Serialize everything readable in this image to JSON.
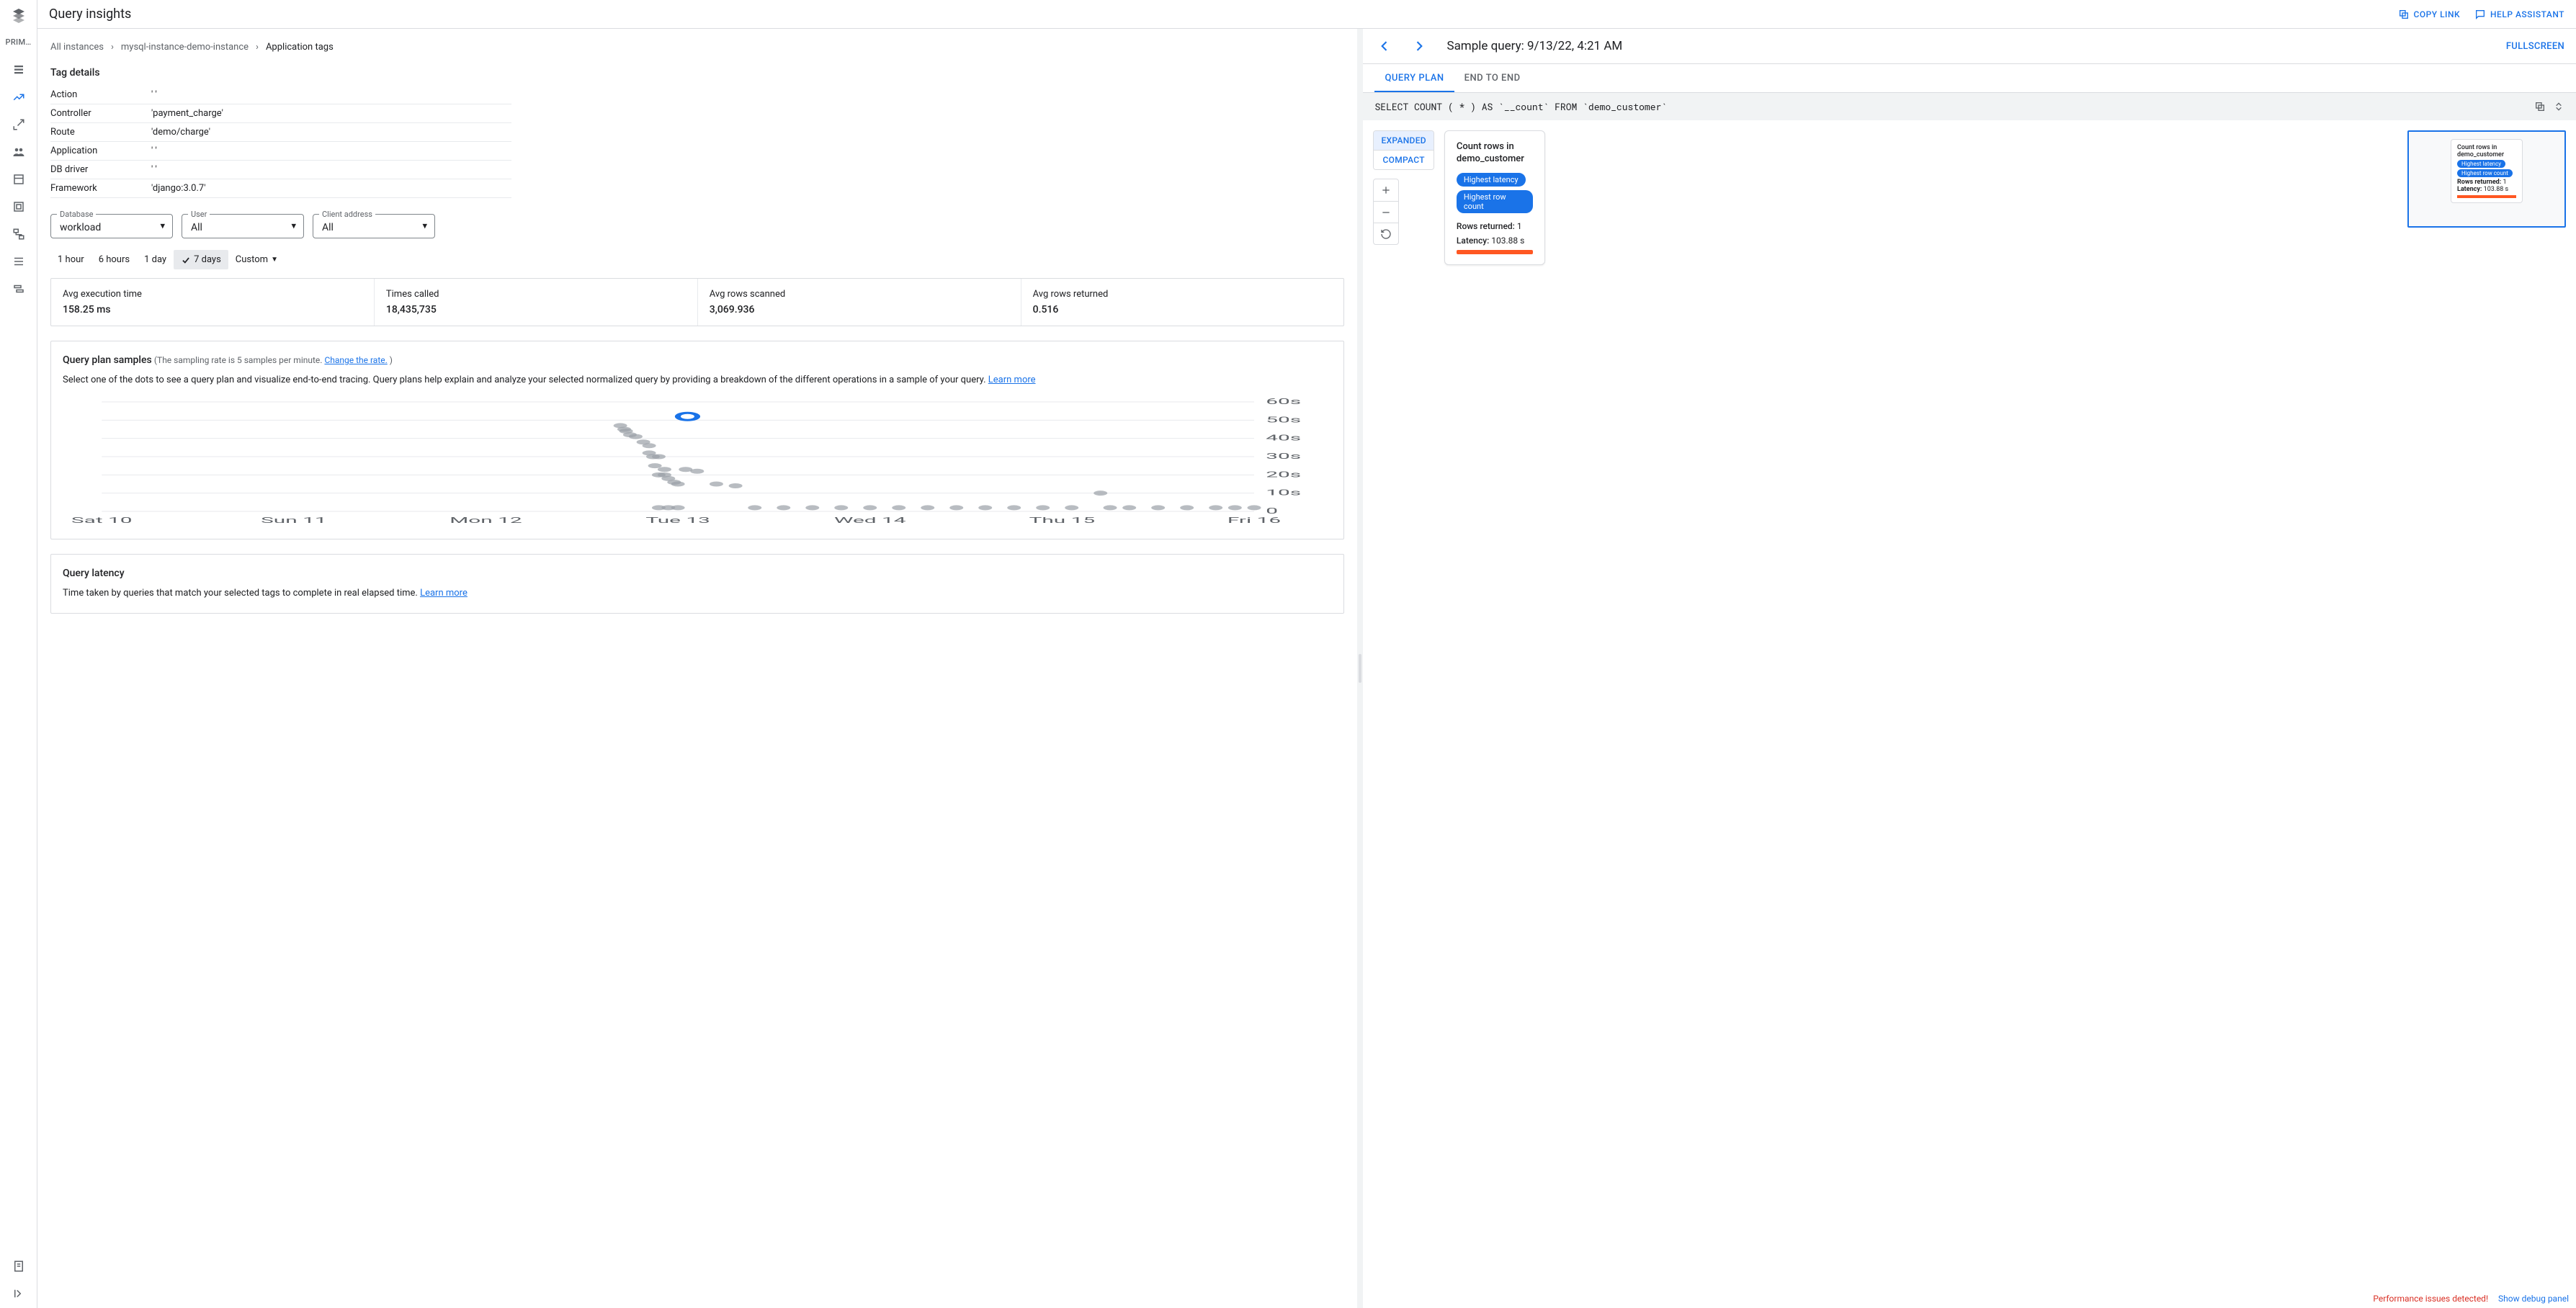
{
  "sidebar": {
    "label": "PRIM…"
  },
  "header": {
    "title": "Query insights",
    "copy_link": "COPY LINK",
    "help": "HELP ASSISTANT"
  },
  "breadcrumbs": {
    "items": [
      "All instances",
      "mysql-instance-demo-instance",
      "Application tags"
    ]
  },
  "tag_details": {
    "title": "Tag details",
    "rows": [
      {
        "k": "Action",
        "v": "' '"
      },
      {
        "k": "Controller",
        "v": "'payment_charge'"
      },
      {
        "k": "Route",
        "v": "'demo/charge'"
      },
      {
        "k": "Application",
        "v": "' '"
      },
      {
        "k": "DB driver",
        "v": "' '"
      },
      {
        "k": "Framework",
        "v": "'django:3.0.7'"
      }
    ]
  },
  "filters": {
    "database": {
      "legend": "Database",
      "value": "workload"
    },
    "user": {
      "legend": "User",
      "value": "All"
    },
    "client": {
      "legend": "Client address",
      "value": "All"
    }
  },
  "timerange": {
    "items": [
      "1 hour",
      "6 hours",
      "1 day",
      "7 days",
      "Custom"
    ],
    "selected": "7 days"
  },
  "stats": {
    "avg_exec": {
      "label": "Avg execution time",
      "value": "158.25 ms"
    },
    "times_called": {
      "label": "Times called",
      "value": "18,435,735"
    },
    "rows_scanned": {
      "label": "Avg rows scanned",
      "value": "3,069.936"
    },
    "rows_returned": {
      "label": "Avg rows returned",
      "value": "0.516"
    }
  },
  "plan_samples": {
    "title": "Query plan samples",
    "hint_prefix": "(The sampling rate is 5 samples per minute. ",
    "change_rate": "Change the rate.",
    "hint_suffix": " )",
    "desc": "Select one of the dots to see a query plan and visualize end-to-end tracing. Query plans help explain and analyze your selected normalized query by providing a breakdown of the different operations in a sample of your query. ",
    "learn_more": "Learn more"
  },
  "latency_card": {
    "title": "Query latency",
    "desc_prefix": "Time taken by queries that match your selected tags to complete in real elapsed time. ",
    "learn_more": "Learn more"
  },
  "right": {
    "title_prefix": "Sample query: ",
    "title_time": "9/13/22, 4:21 AM",
    "fullscreen": "FULLSCREEN",
    "tabs": {
      "plan": "QUERY PLAN",
      "e2e": "END TO END"
    },
    "query_text": "SELECT COUNT ( * ) AS `__count` FROM `demo_customer`",
    "view_modes": {
      "expanded": "EXPANDED",
      "compact": "COMPACT"
    },
    "node": {
      "title": "Count rows in demo_customer",
      "badge1": "Highest latency",
      "badge2": "Highest row count",
      "rows_label": "Rows returned: ",
      "rows_value": "1",
      "latency_label": "Latency: ",
      "latency_value": "103.88 s"
    }
  },
  "bottom": {
    "perf": "Performance issues detected!",
    "debug": "Show debug panel"
  },
  "chart_data": {
    "type": "scatter",
    "title": "Query plan samples",
    "xlabel": "",
    "ylabel": "",
    "ylim": [
      0,
      60
    ],
    "y_ticks": [
      "0",
      "10s",
      "20s",
      "30s",
      "40s",
      "50s",
      "60s"
    ],
    "x_ticks": [
      "Sat 10",
      "Sun 11",
      "Mon 12",
      "Tue 13",
      "Wed 14",
      "Thu 15",
      "Fri 16"
    ],
    "selected": {
      "x": 3.05,
      "y": 52
    },
    "points": [
      {
        "x": 2.7,
        "y": 47
      },
      {
        "x": 2.72,
        "y": 45
      },
      {
        "x": 2.73,
        "y": 44
      },
      {
        "x": 2.75,
        "y": 42
      },
      {
        "x": 2.78,
        "y": 41
      },
      {
        "x": 2.82,
        "y": 38
      },
      {
        "x": 2.85,
        "y": 36
      },
      {
        "x": 2.85,
        "y": 32
      },
      {
        "x": 2.87,
        "y": 30
      },
      {
        "x": 2.9,
        "y": 30
      },
      {
        "x": 2.88,
        "y": 25
      },
      {
        "x": 2.93,
        "y": 23
      },
      {
        "x": 2.9,
        "y": 20
      },
      {
        "x": 2.93,
        "y": 20
      },
      {
        "x": 2.95,
        "y": 18
      },
      {
        "x": 2.98,
        "y": 16
      },
      {
        "x": 3.0,
        "y": 15
      },
      {
        "x": 3.04,
        "y": 23
      },
      {
        "x": 3.1,
        "y": 22
      },
      {
        "x": 3.2,
        "y": 15
      },
      {
        "x": 3.3,
        "y": 14
      },
      {
        "x": 2.9,
        "y": 2
      },
      {
        "x": 2.95,
        "y": 2
      },
      {
        "x": 3.0,
        "y": 2
      },
      {
        "x": 3.4,
        "y": 2
      },
      {
        "x": 3.55,
        "y": 2
      },
      {
        "x": 3.7,
        "y": 2
      },
      {
        "x": 3.85,
        "y": 2
      },
      {
        "x": 4.0,
        "y": 2
      },
      {
        "x": 4.15,
        "y": 2
      },
      {
        "x": 4.3,
        "y": 2
      },
      {
        "x": 4.45,
        "y": 2
      },
      {
        "x": 4.6,
        "y": 2
      },
      {
        "x": 4.75,
        "y": 2
      },
      {
        "x": 4.9,
        "y": 2
      },
      {
        "x": 5.05,
        "y": 2
      },
      {
        "x": 5.2,
        "y": 10
      },
      {
        "x": 5.25,
        "y": 2
      },
      {
        "x": 5.35,
        "y": 2
      },
      {
        "x": 5.5,
        "y": 2
      },
      {
        "x": 5.65,
        "y": 2
      },
      {
        "x": 5.8,
        "y": 2
      },
      {
        "x": 5.9,
        "y": 2
      },
      {
        "x": 6.0,
        "y": 2
      }
    ]
  }
}
